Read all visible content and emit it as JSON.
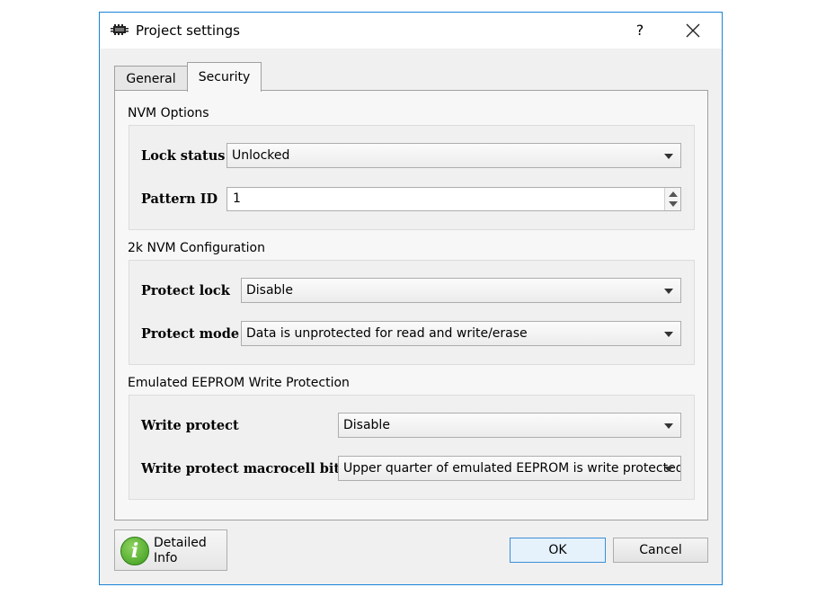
{
  "window": {
    "title": "Project settings",
    "help_label": "?",
    "app_icon": "chip-icon",
    "close_icon": "close-icon"
  },
  "tabs": [
    {
      "label": "General",
      "selected": false
    },
    {
      "label": "Security",
      "selected": true
    }
  ],
  "nvm_options": {
    "title": "NVM Options",
    "lock_status_label": "Lock status",
    "lock_status_value": "Unlocked",
    "pattern_id_label": "Pattern ID",
    "pattern_id_value": "1"
  },
  "nvm_2k": {
    "title": "2k NVM Configuration",
    "protect_lock_label": "Protect lock",
    "protect_lock_value": "Disable",
    "protect_mode_label": "Protect mode",
    "protect_mode_value": "Data is unprotected for read and write/erase"
  },
  "eeprom": {
    "title": "Emulated EEPROM Write Protection",
    "write_protect_label": "Write protect",
    "write_protect_value": "Disable",
    "macrocell_label": "Write protect macrocell bits",
    "macrocell_value": "Upper quarter of emulated EEPROM is write protected"
  },
  "footer": {
    "info_line1": "Detailed",
    "info_line2": "Info",
    "info_icon": "info-icon",
    "ok_label": "OK",
    "cancel_label": "Cancel"
  },
  "colors": {
    "window_border": "#1883d7",
    "info_green": "#4caf2a",
    "ok_border": "#3c8fd8"
  }
}
